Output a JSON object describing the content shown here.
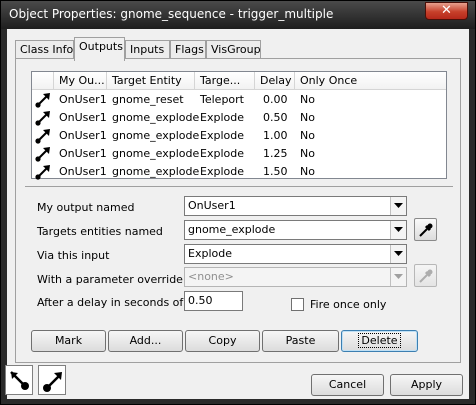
{
  "window": {
    "title": "Object Properties: gnome_sequence - trigger_multiple",
    "close_glyph": "✕"
  },
  "tabs": [
    {
      "label": "Class Info"
    },
    {
      "label": "Outputs",
      "active": true
    },
    {
      "label": "Inputs"
    },
    {
      "label": "Flags"
    },
    {
      "label": "VisGroup"
    }
  ],
  "list": {
    "columns": [
      "My Ou...",
      "Target Entity",
      "Targe...",
      "Delay",
      "Only Once"
    ],
    "rows": [
      {
        "output": "OnUser1",
        "target": "gnome_reset",
        "input": "Teleport",
        "delay": "0.00",
        "once": "No"
      },
      {
        "output": "OnUser1",
        "target": "gnome_explode",
        "input": "Explode",
        "delay": "0.50",
        "once": "No"
      },
      {
        "output": "OnUser1",
        "target": "gnome_explode",
        "input": "Explode",
        "delay": "1.00",
        "once": "No"
      },
      {
        "output": "OnUser1",
        "target": "gnome_explode",
        "input": "Explode",
        "delay": "1.25",
        "once": "No"
      },
      {
        "output": "OnUser1",
        "target": "gnome_explode",
        "input": "Explode",
        "delay": "1.50",
        "once": "No"
      }
    ]
  },
  "form": {
    "output_label": "My output named",
    "output_value": "OnUser1",
    "target_label": "Targets entities named",
    "target_value": "gnome_explode",
    "input_label": "Via this input",
    "input_value": "Explode",
    "param_label": "With a parameter override of",
    "param_value": "<none>",
    "delay_label": "After a delay in seconds of",
    "delay_value": "0.50",
    "fire_once_label": "Fire once only"
  },
  "buttons": {
    "mark": "Mark",
    "add": "Add...",
    "copy": "Copy",
    "paste": "Paste",
    "delete": "Delete"
  },
  "footer": {
    "cancel": "Cancel",
    "apply": "Apply"
  },
  "colors": {
    "titlebar": "#2a2a2a",
    "close": "#c7402a",
    "panel": "#f0f0f0",
    "focus_border": "#3c7fb1"
  },
  "icons": {
    "row": "output-connection-icon",
    "picker": "eyedropper-icon",
    "mode_a": "output-mode-icon",
    "mode_b": "input-mode-icon"
  }
}
